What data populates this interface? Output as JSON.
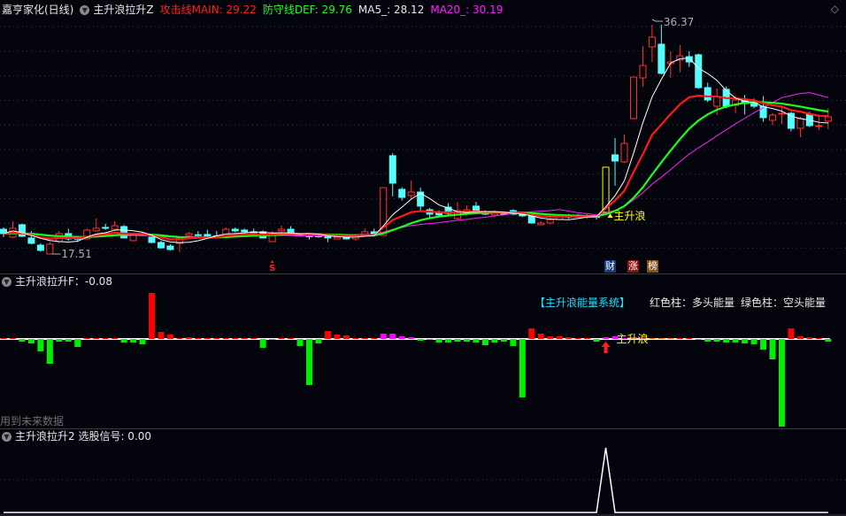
{
  "header": {
    "stock_name": "嘉亨家化(日线)",
    "indicator_name": "主升浪拉升Z",
    "main_line": {
      "label": "攻击线MAIN: 29.22",
      "color": "#ff2020"
    },
    "def_line": {
      "label": "防守线DEF: 29.76",
      "color": "#20ff20"
    },
    "ma5": {
      "label": "MA5_: 28.12",
      "color": "#ffffff"
    },
    "ma20": {
      "label": "MA20_: 30.19",
      "color": "#ff20ff"
    }
  },
  "main_chart": {
    "high_label": "36.37",
    "low_label": "17.51",
    "signal_label": "主升浪",
    "s_mark": "S",
    "badges": [
      "财",
      "涨",
      "榜"
    ],
    "price_range": [
      17.51,
      36.37
    ],
    "candles_ohlc": [
      [
        19.55,
        19.19,
        19.7,
        18.9
      ],
      [
        18.9,
        19.63,
        20.21,
        18.8
      ],
      [
        19.92,
        18.97,
        20.0,
        18.9
      ],
      [
        18.83,
        18.39,
        19.4,
        18.3
      ],
      [
        18.24,
        17.81,
        18.4,
        17.7
      ],
      [
        17.51,
        18.32,
        18.5,
        17.51
      ],
      [
        18.53,
        19.19,
        19.4,
        18.4
      ],
      [
        19.19,
        18.75,
        19.6,
        18.6
      ],
      [
        18.8,
        18.75,
        19.0,
        18.5
      ],
      [
        18.75,
        19.48,
        19.6,
        18.7
      ],
      [
        19.41,
        19.63,
        20.43,
        19.35
      ],
      [
        19.7,
        19.68,
        20.0,
        19.5
      ],
      [
        19.55,
        19.84,
        20.21,
        19.5
      ],
      [
        19.77,
        18.83,
        19.9,
        18.8
      ],
      [
        18.61,
        19.12,
        19.2,
        18.55
      ],
      [
        19.1,
        19.05,
        19.3,
        19.0
      ],
      [
        18.9,
        18.46,
        19.0,
        18.4
      ],
      [
        18.46,
        18.02,
        18.6,
        17.95
      ],
      [
        18.17,
        17.88,
        18.3,
        17.8
      ],
      [
        18.39,
        18.83,
        18.9,
        17.66
      ],
      [
        19.04,
        19.19,
        19.35,
        18.9
      ],
      [
        19.1,
        19.08,
        19.4,
        18.9
      ],
      [
        19.12,
        18.97,
        19.5,
        18.9
      ],
      [
        19.0,
        18.98,
        19.4,
        18.8
      ],
      [
        18.97,
        19.55,
        19.7,
        18.9
      ],
      [
        19.55,
        19.41,
        19.7,
        19.3
      ],
      [
        19.48,
        19.34,
        19.6,
        19.2
      ],
      [
        19.34,
        19.32,
        19.6,
        19.1
      ],
      [
        19.34,
        18.83,
        19.45,
        18.8
      ],
      [
        18.53,
        19.26,
        19.4,
        18.5
      ],
      [
        19.41,
        19.55,
        19.85,
        19.35
      ],
      [
        19.55,
        19.19,
        19.8,
        19.1
      ],
      [
        19.1,
        19.05,
        19.2,
        18.95
      ],
      [
        19.0,
        18.98,
        19.2,
        18.7
      ],
      [
        19.0,
        18.99,
        19.1,
        18.85
      ],
      [
        18.97,
        18.83,
        19.05,
        18.5
      ],
      [
        18.75,
        18.9,
        18.95,
        18.7
      ],
      [
        18.97,
        18.75,
        19.0,
        18.7
      ],
      [
        18.75,
        19.04,
        19.1,
        18.6
      ],
      [
        19.04,
        19.34,
        19.63,
        18.95
      ],
      [
        19.34,
        19.04,
        19.6,
        18.95
      ],
      [
        19.04,
        22.97,
        23.0,
        19.0
      ],
      [
        25.6,
        23.34,
        25.8,
        22.25
      ],
      [
        22.83,
        22.17,
        23.0,
        21.9
      ],
      [
        22.32,
        22.61,
        23.55,
        22.0
      ],
      [
        22.61,
        21.45,
        22.97,
        21.0
      ],
      [
        21.15,
        20.79,
        21.3,
        20.5
      ],
      [
        20.94,
        20.72,
        21.1,
        20.6
      ],
      [
        21.37,
        20.86,
        21.7,
        20.7
      ],
      [
        20.43,
        21.08,
        21.8,
        20.3
      ],
      [
        20.86,
        21.15,
        21.5,
        20.7
      ],
      [
        21.45,
        21.08,
        21.8,
        20.95
      ],
      [
        20.94,
        20.79,
        21.1,
        20.7
      ],
      [
        20.72,
        20.94,
        21.1,
        20.65
      ],
      [
        20.85,
        20.8,
        21.0,
        20.7
      ],
      [
        21.08,
        20.79,
        21.2,
        20.7
      ],
      [
        20.79,
        20.65,
        20.9,
        20.55
      ],
      [
        20.65,
        20.06,
        20.75,
        20.0
      ],
      [
        19.92,
        20.06,
        20.2,
        19.9
      ],
      [
        20.06,
        20.35,
        20.5,
        19.95
      ],
      [
        20.35,
        20.65,
        20.8,
        20.3
      ],
      [
        20.6,
        20.55,
        20.8,
        20.4
      ],
      [
        20.7,
        20.55,
        20.8,
        20.5
      ],
      [
        20.6,
        20.65,
        20.8,
        20.4
      ],
      [
        20.6,
        20.55,
        20.75,
        20.35
      ],
      [
        20.94,
        24.65,
        24.7,
        20.9
      ],
      [
        25.67,
        25.16,
        27.05,
        23.12
      ],
      [
        25.09,
        26.61,
        27.34,
        25.0
      ],
      [
        28.65,
        32.07,
        32.1,
        28.6
      ],
      [
        32.0,
        33.02,
        34.62,
        31.27
      ],
      [
        34.55,
        35.35,
        36.37,
        33.31
      ],
      [
        34.77,
        32.37,
        36.37,
        32.3
      ],
      [
        33.17,
        33.31,
        34.19,
        32.0
      ],
      [
        33.46,
        33.82,
        34.7,
        32.44
      ],
      [
        33.75,
        33.31,
        34.2,
        32.9
      ],
      [
        33.9,
        31.2,
        34.0,
        31.1
      ],
      [
        31.2,
        30.18,
        31.6,
        30.0
      ],
      [
        29.67,
        30.47,
        31.13,
        28.94
      ],
      [
        31.06,
        29.67,
        31.3,
        29.5
      ],
      [
        29.74,
        30.18,
        30.5,
        29.1
      ],
      [
        30.11,
        29.89,
        30.6,
        29.0
      ],
      [
        29.96,
        29.67,
        30.3,
        29.5
      ],
      [
        29.67,
        28.73,
        30.5,
        28.4
      ],
      [
        28.51,
        28.94,
        29.1,
        28.1
      ],
      [
        29.02,
        29.09,
        29.6,
        28.2
      ],
      [
        29.09,
        27.85,
        29.2,
        27.6
      ],
      [
        27.85,
        28.65,
        28.8,
        27.12
      ],
      [
        29.02,
        28.07,
        29.2,
        27.95
      ],
      [
        28.0,
        28.07,
        29.0,
        27.7
      ],
      [
        28.44,
        28.8,
        29.5,
        27.8
      ]
    ],
    "signal_index": 65,
    "high_index": 70,
    "low_index": 5,
    "s_mark_index": 29,
    "colors": {
      "up": "#ff3232",
      "down": "#54ffff",
      "signal": "#ffff00",
      "main": "#ff1a1a",
      "def": "#1aff1a",
      "ma5": "#ffffff",
      "ma20": "#ff20ff"
    }
  },
  "energy_panel": {
    "title": "主升浪拉升F：-0.08",
    "system_label": "【主升浪能量系统】",
    "legend_red": "红色柱：多头能量",
    "legend_green": "绿色柱：空头能量",
    "signal_label": "主升浪",
    "future_data_note": "用到未来数据",
    "values": [
      0,
      0,
      -3,
      -5,
      -14,
      -28,
      -3,
      -3,
      -9,
      1,
      1,
      1,
      1,
      -4,
      -4,
      -6,
      52,
      8,
      5,
      1,
      2,
      1,
      1,
      1,
      1,
      1,
      1,
      1,
      -10,
      -1,
      0,
      0,
      -8,
      -52,
      -5,
      9,
      5,
      4,
      1,
      1,
      0,
      6,
      6,
      3,
      2,
      -2,
      -1,
      -4,
      -4,
      -3,
      -3,
      -4,
      -7,
      -4,
      -3,
      -8,
      -66,
      12,
      6,
      3,
      3,
      2,
      1,
      1,
      -3,
      2,
      3,
      1,
      1,
      1,
      1,
      1,
      1,
      0,
      0,
      -1,
      -3,
      -3,
      -4,
      -4,
      -5,
      -6,
      -12,
      -23,
      -99,
      12,
      3,
      2,
      1,
      -3
    ],
    "magenta_indices": [
      41,
      42,
      43,
      44,
      65,
      66,
      67,
      68,
      69
    ],
    "orange_indices": [
      70,
      71,
      72
    ],
    "colors": {
      "positive": "#ff0000",
      "negative": "#00ee00",
      "magenta": "#ff00ff",
      "orange": "#ff6a00"
    }
  },
  "signal_panel": {
    "title": "主升浪拉升2 选股信号: 0.00",
    "signals_index_on": [
      65
    ]
  }
}
